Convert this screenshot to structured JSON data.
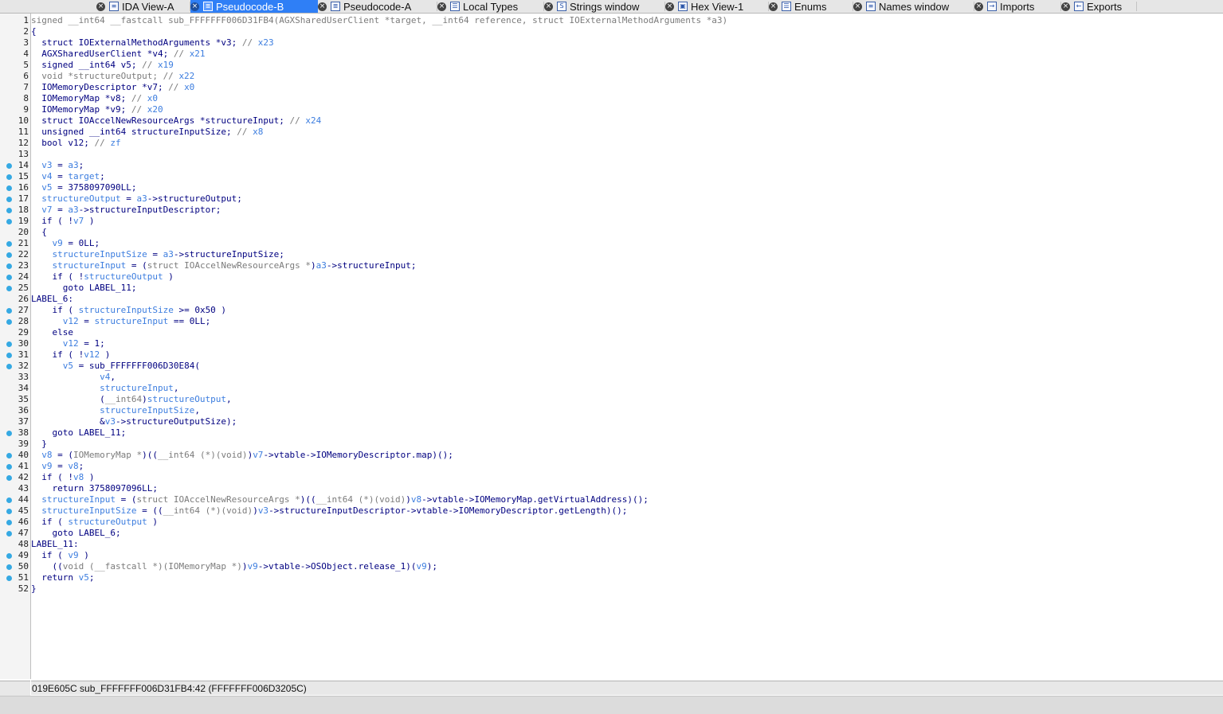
{
  "tabs": [
    {
      "label": "IDA View-A",
      "icon": "disassembly-icon",
      "active": false
    },
    {
      "label": "Pseudocode-B",
      "icon": "pseudocode-icon",
      "active": true
    },
    {
      "label": "Pseudocode-A",
      "icon": "pseudocode-icon",
      "active": false
    },
    {
      "label": "Local Types",
      "icon": "local-types-icon",
      "active": false
    },
    {
      "label": "Strings window",
      "icon": "strings-icon",
      "active": false
    },
    {
      "label": "Hex View-1",
      "icon": "hex-icon",
      "active": false
    },
    {
      "label": "Enums",
      "icon": "enums-icon",
      "active": false
    },
    {
      "label": "Names window",
      "icon": "names-icon",
      "active": false
    },
    {
      "label": "Imports",
      "icon": "imports-icon",
      "active": false
    },
    {
      "label": "Exports",
      "icon": "exports-icon",
      "active": false
    }
  ],
  "colors": {
    "active_tab": "#2f7ff6",
    "variable": "#3c7ddf",
    "code_text": "#000080",
    "comment": "#7b7b7b",
    "breakpoint_dot": "#35a9e3"
  },
  "code_lines": [
    {
      "n": "1",
      "dot": false,
      "segs": [
        [
          "c",
          "signed __int64 __fastcall sub_FFFFFFF006D31FB4(AGXSharedUserClient *target, __int64 reference, struct IOExternalMethodArguments *a3)"
        ]
      ]
    },
    {
      "n": "2",
      "dot": false,
      "segs": [
        [
          "n",
          "{"
        ]
      ]
    },
    {
      "n": "3",
      "dot": false,
      "segs": [
        [
          "n",
          "  struct IOExternalMethodArguments *v3; "
        ],
        [
          "c",
          "// "
        ],
        [
          "v",
          "x23"
        ]
      ]
    },
    {
      "n": "4",
      "dot": false,
      "segs": [
        [
          "n",
          "  AGXSharedUserClient *v4; "
        ],
        [
          "c",
          "// "
        ],
        [
          "v",
          "x21"
        ]
      ]
    },
    {
      "n": "5",
      "dot": false,
      "segs": [
        [
          "n",
          "  signed __int64 v5; "
        ],
        [
          "c",
          "// "
        ],
        [
          "v",
          "x19"
        ]
      ]
    },
    {
      "n": "6",
      "dot": false,
      "segs": [
        [
          "c",
          "  void *structureOutput; // "
        ],
        [
          "v",
          "x22"
        ]
      ]
    },
    {
      "n": "7",
      "dot": false,
      "segs": [
        [
          "n",
          "  IOMemoryDescriptor *v7; "
        ],
        [
          "c",
          "// "
        ],
        [
          "v",
          "x0"
        ]
      ]
    },
    {
      "n": "8",
      "dot": false,
      "segs": [
        [
          "n",
          "  IOMemoryMap *v8; "
        ],
        [
          "c",
          "// "
        ],
        [
          "v",
          "x0"
        ]
      ]
    },
    {
      "n": "9",
      "dot": false,
      "segs": [
        [
          "n",
          "  IOMemoryMap *v9; "
        ],
        [
          "c",
          "// "
        ],
        [
          "v",
          "x20"
        ]
      ]
    },
    {
      "n": "10",
      "dot": false,
      "segs": [
        [
          "n",
          "  struct IOAccelNewResourceArgs *structureInput; "
        ],
        [
          "c",
          "// "
        ],
        [
          "v",
          "x24"
        ]
      ]
    },
    {
      "n": "11",
      "dot": false,
      "segs": [
        [
          "n",
          "  unsigned __int64 structureInputSize; "
        ],
        [
          "c",
          "// "
        ],
        [
          "v",
          "x8"
        ]
      ]
    },
    {
      "n": "12",
      "dot": false,
      "segs": [
        [
          "n",
          "  bool v12; "
        ],
        [
          "c",
          "// "
        ],
        [
          "v",
          "zf"
        ]
      ]
    },
    {
      "n": "13",
      "dot": false,
      "segs": [
        [
          "n",
          ""
        ]
      ]
    },
    {
      "n": "14",
      "dot": true,
      "segs": [
        [
          "n",
          "  "
        ],
        [
          "v",
          "v3"
        ],
        [
          "n",
          " = "
        ],
        [
          "v",
          "a3"
        ],
        [
          "n",
          ";"
        ]
      ]
    },
    {
      "n": "15",
      "dot": true,
      "segs": [
        [
          "n",
          "  "
        ],
        [
          "v",
          "v4"
        ],
        [
          "n",
          " = "
        ],
        [
          "v",
          "target"
        ],
        [
          "n",
          ";"
        ]
      ]
    },
    {
      "n": "16",
      "dot": true,
      "segs": [
        [
          "n",
          "  "
        ],
        [
          "v",
          "v5"
        ],
        [
          "n",
          " = 3758097090LL;"
        ]
      ]
    },
    {
      "n": "17",
      "dot": true,
      "segs": [
        [
          "n",
          "  "
        ],
        [
          "v",
          "structureOutput"
        ],
        [
          "n",
          " = "
        ],
        [
          "v",
          "a3"
        ],
        [
          "n",
          "->structureOutput;"
        ]
      ]
    },
    {
      "n": "18",
      "dot": true,
      "segs": [
        [
          "n",
          "  "
        ],
        [
          "v",
          "v7"
        ],
        [
          "n",
          " = "
        ],
        [
          "v",
          "a3"
        ],
        [
          "n",
          "->structureInputDescriptor;"
        ]
      ]
    },
    {
      "n": "19",
      "dot": true,
      "segs": [
        [
          "n",
          "  if ( !"
        ],
        [
          "v",
          "v7"
        ],
        [
          "n",
          " )"
        ]
      ]
    },
    {
      "n": "20",
      "dot": false,
      "segs": [
        [
          "n",
          "  {"
        ]
      ]
    },
    {
      "n": "21",
      "dot": true,
      "segs": [
        [
          "n",
          "    "
        ],
        [
          "v",
          "v9"
        ],
        [
          "n",
          " = 0LL;"
        ]
      ]
    },
    {
      "n": "22",
      "dot": true,
      "segs": [
        [
          "n",
          "    "
        ],
        [
          "v",
          "structureInputSize"
        ],
        [
          "n",
          " = "
        ],
        [
          "v",
          "a3"
        ],
        [
          "n",
          "->structureInputSize;"
        ]
      ]
    },
    {
      "n": "23",
      "dot": true,
      "segs": [
        [
          "n",
          "    "
        ],
        [
          "v",
          "structureInput"
        ],
        [
          "n",
          " = ("
        ],
        [
          "c",
          "struct IOAccelNewResourceArgs *"
        ],
        [
          "n",
          ")"
        ],
        [
          "v",
          "a3"
        ],
        [
          "n",
          "->structureInput;"
        ]
      ]
    },
    {
      "n": "24",
      "dot": true,
      "segs": [
        [
          "n",
          "    if ( !"
        ],
        [
          "v",
          "structureOutput"
        ],
        [
          "n",
          " )"
        ]
      ]
    },
    {
      "n": "25",
      "dot": true,
      "segs": [
        [
          "n",
          "      goto LABEL_11;"
        ]
      ]
    },
    {
      "n": "26",
      "dot": false,
      "segs": [
        [
          "n",
          "LABEL_6:"
        ]
      ]
    },
    {
      "n": "27",
      "dot": true,
      "segs": [
        [
          "n",
          "    if ( "
        ],
        [
          "v",
          "structureInputSize"
        ],
        [
          "n",
          " >= 0x50 )"
        ]
      ]
    },
    {
      "n": "28",
      "dot": true,
      "segs": [
        [
          "n",
          "      "
        ],
        [
          "v",
          "v12"
        ],
        [
          "n",
          " = "
        ],
        [
          "v",
          "structureInput"
        ],
        [
          "n",
          " == 0LL;"
        ]
      ]
    },
    {
      "n": "29",
      "dot": false,
      "segs": [
        [
          "n",
          "    else"
        ]
      ]
    },
    {
      "n": "30",
      "dot": true,
      "segs": [
        [
          "n",
          "      "
        ],
        [
          "v",
          "v12"
        ],
        [
          "n",
          " = 1;"
        ]
      ]
    },
    {
      "n": "31",
      "dot": true,
      "segs": [
        [
          "n",
          "    if ( !"
        ],
        [
          "v",
          "v12"
        ],
        [
          "n",
          " )"
        ]
      ]
    },
    {
      "n": "32",
      "dot": true,
      "segs": [
        [
          "n",
          "      "
        ],
        [
          "v",
          "v5"
        ],
        [
          "n",
          " = sub_FFFFFFF006D30E84("
        ]
      ]
    },
    {
      "n": "33",
      "dot": false,
      "segs": [
        [
          "n",
          "             "
        ],
        [
          "v",
          "v4"
        ],
        [
          "n",
          ","
        ]
      ]
    },
    {
      "n": "34",
      "dot": false,
      "segs": [
        [
          "n",
          "             "
        ],
        [
          "v",
          "structureInput"
        ],
        [
          "n",
          ","
        ]
      ]
    },
    {
      "n": "35",
      "dot": false,
      "segs": [
        [
          "n",
          "             ("
        ],
        [
          "c",
          "__int64"
        ],
        [
          "n",
          ")"
        ],
        [
          "v",
          "structureOutput"
        ],
        [
          "n",
          ","
        ]
      ]
    },
    {
      "n": "36",
      "dot": false,
      "segs": [
        [
          "n",
          "             "
        ],
        [
          "v",
          "structureInputSize"
        ],
        [
          "n",
          ","
        ]
      ]
    },
    {
      "n": "37",
      "dot": false,
      "segs": [
        [
          "n",
          "             &"
        ],
        [
          "v",
          "v3"
        ],
        [
          "n",
          "->structureOutputSize);"
        ]
      ]
    },
    {
      "n": "38",
      "dot": true,
      "segs": [
        [
          "n",
          "    goto LABEL_11;"
        ]
      ]
    },
    {
      "n": "39",
      "dot": false,
      "segs": [
        [
          "n",
          "  }"
        ]
      ]
    },
    {
      "n": "40",
      "dot": true,
      "segs": [
        [
          "n",
          "  "
        ],
        [
          "v",
          "v8"
        ],
        [
          "n",
          " = ("
        ],
        [
          "c",
          "IOMemoryMap *"
        ],
        [
          "n",
          ")(("
        ],
        [
          "c",
          "__int64 (*)(void)"
        ],
        [
          "n",
          ")"
        ],
        [
          "v",
          "v7"
        ],
        [
          "n",
          "->vtable->IOMemoryDescriptor.map)();"
        ]
      ]
    },
    {
      "n": "41",
      "dot": true,
      "segs": [
        [
          "n",
          "  "
        ],
        [
          "v",
          "v9"
        ],
        [
          "n",
          " = "
        ],
        [
          "v",
          "v8"
        ],
        [
          "n",
          ";"
        ]
      ]
    },
    {
      "n": "42",
      "dot": true,
      "segs": [
        [
          "n",
          "  if ( !"
        ],
        [
          "v",
          "v8"
        ],
        [
          "n",
          " )"
        ]
      ]
    },
    {
      "n": "43",
      "dot": false,
      "segs": [
        [
          "n",
          "    return 3758097096LL;"
        ]
      ]
    },
    {
      "n": "44",
      "dot": true,
      "segs": [
        [
          "n",
          "  "
        ],
        [
          "v",
          "structureInput"
        ],
        [
          "n",
          " = ("
        ],
        [
          "c",
          "struct IOAccelNewResourceArgs *"
        ],
        [
          "n",
          ")(("
        ],
        [
          "c",
          "__int64 (*)(void)"
        ],
        [
          "n",
          ")"
        ],
        [
          "v",
          "v8"
        ],
        [
          "n",
          "->vtable->IOMemoryMap.getVirtualAddress)();"
        ]
      ]
    },
    {
      "n": "45",
      "dot": true,
      "segs": [
        [
          "n",
          "  "
        ],
        [
          "v",
          "structureInputSize"
        ],
        [
          "n",
          " = (("
        ],
        [
          "c",
          "__int64 (*)(void)"
        ],
        [
          "n",
          ")"
        ],
        [
          "v",
          "v3"
        ],
        [
          "n",
          "->structureInputDescriptor->vtable->IOMemoryDescriptor.getLength)();"
        ]
      ]
    },
    {
      "n": "46",
      "dot": true,
      "segs": [
        [
          "n",
          "  if ( "
        ],
        [
          "v",
          "structureOutput"
        ],
        [
          "n",
          " )"
        ]
      ]
    },
    {
      "n": "47",
      "dot": true,
      "segs": [
        [
          "n",
          "    goto LABEL_6;"
        ]
      ]
    },
    {
      "n": "48",
      "dot": false,
      "segs": [
        [
          "n",
          "LABEL_11:"
        ]
      ]
    },
    {
      "n": "49",
      "dot": true,
      "segs": [
        [
          "n",
          "  if ( "
        ],
        [
          "v",
          "v9"
        ],
        [
          "n",
          " )"
        ]
      ]
    },
    {
      "n": "50",
      "dot": true,
      "segs": [
        [
          "n",
          "    (("
        ],
        [
          "c",
          "void (__fastcall *)(IOMemoryMap *)"
        ],
        [
          "n",
          ")"
        ],
        [
          "v",
          "v9"
        ],
        [
          "n",
          "->vtable->OSObject.release_1)("
        ],
        [
          "v",
          "v9"
        ],
        [
          "n",
          ");"
        ]
      ]
    },
    {
      "n": "51",
      "dot": true,
      "segs": [
        [
          "n",
          "  return "
        ],
        [
          "v",
          "v5"
        ],
        [
          "n",
          ";"
        ]
      ]
    },
    {
      "n": "52",
      "dot": false,
      "segs": [
        [
          "n",
          "}"
        ]
      ]
    }
  ],
  "status_bar": {
    "text": "019E605C  sub_FFFFFFF006D31FB4:42 (FFFFFFF006D3205C)"
  }
}
